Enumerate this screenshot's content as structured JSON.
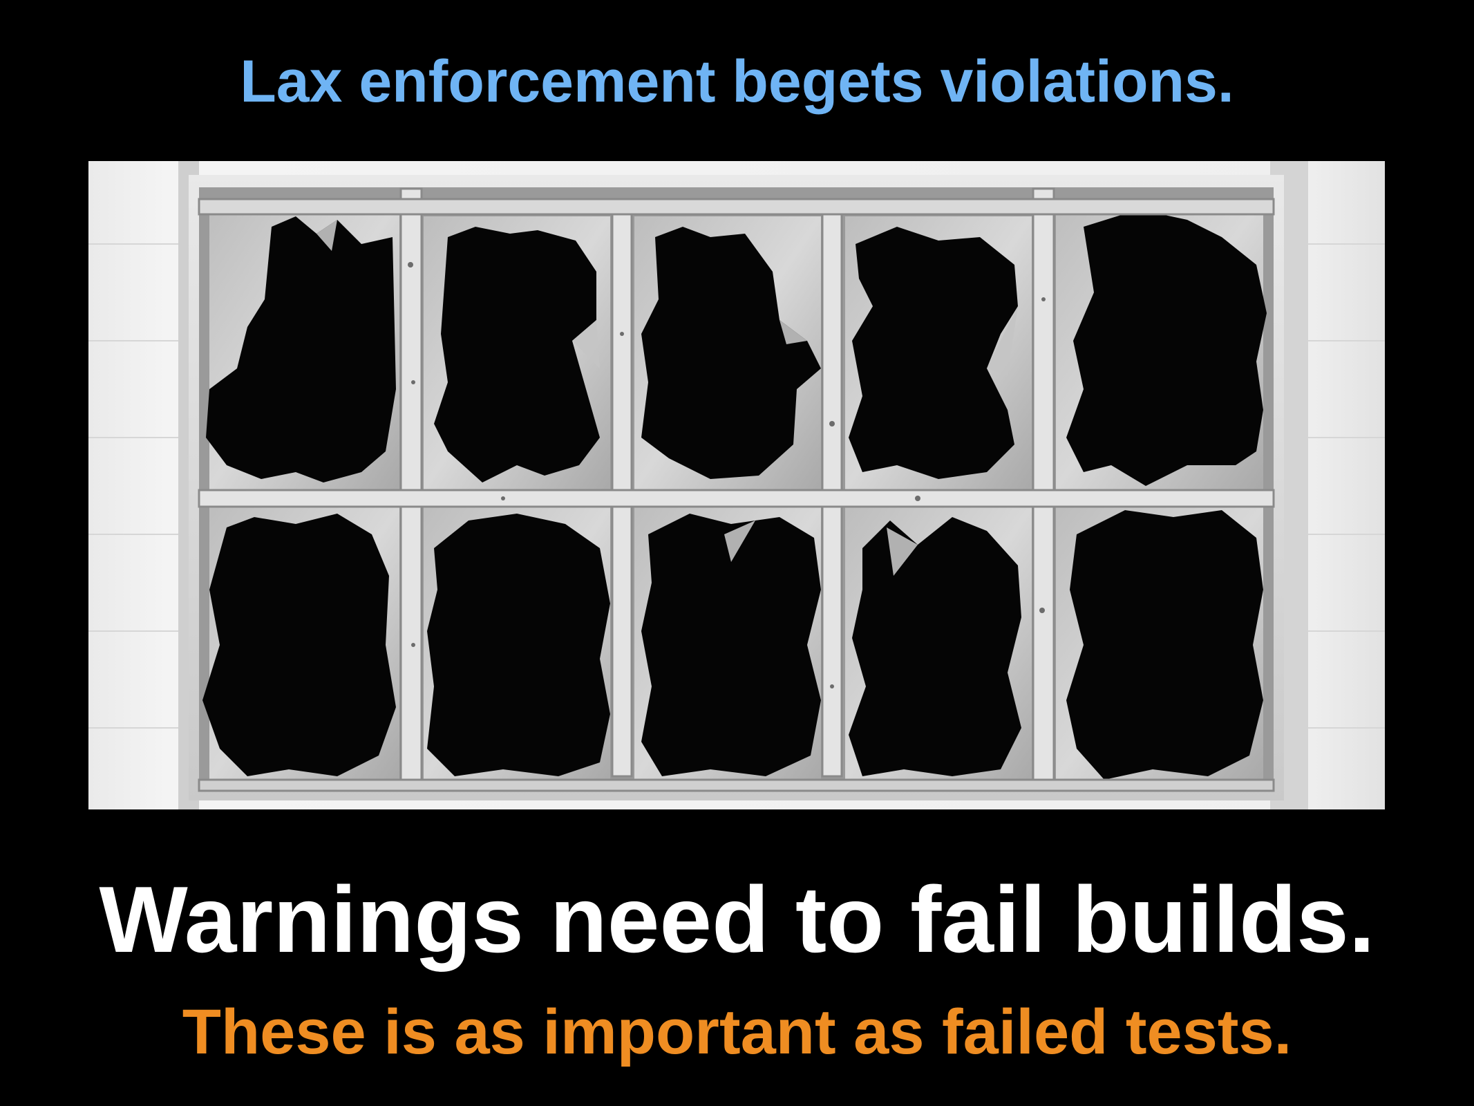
{
  "slide": {
    "top_caption": "Lax enforcement begets violations.",
    "headline": "Warnings need to fail builds.",
    "subline": "These is as important as failed tests."
  },
  "colors": {
    "background": "#000000",
    "top_caption": "#6fb4f4",
    "headline": "#ffffff",
    "subline": "#ef8d22"
  },
  "image": {
    "subject": "broken-window-photo",
    "style": "black-and-white"
  }
}
